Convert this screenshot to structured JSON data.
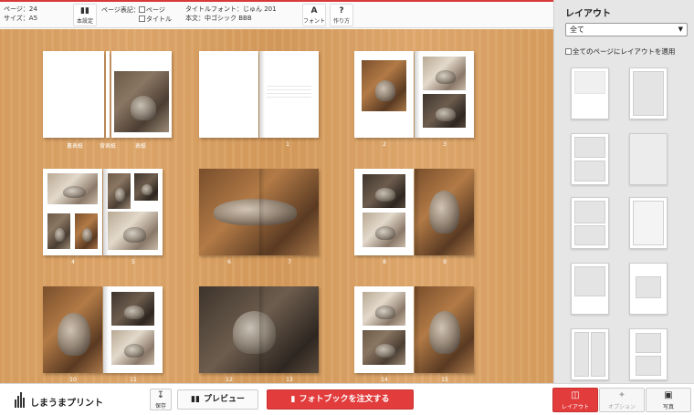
{
  "toolbar": {
    "page_count_label": "ページ：24",
    "size_label": "サイズ：A5",
    "book_settings_label": "本設定",
    "page_notation_label": "ページ表記：",
    "page_check_label": "ページ",
    "title_check_label": "タイトル",
    "title_font_label": "タイトルフォント：じゅん 201",
    "body_font_label": "本文：中ゴシック BBB",
    "font_button_label": "フォント",
    "help_button_label": "作り方"
  },
  "spreads": [
    {
      "captions": [
        "裏表紙",
        "背表紙",
        "表紙"
      ]
    },
    {
      "captions": [
        "1"
      ]
    },
    {
      "captions": [
        "2",
        "3"
      ]
    },
    {
      "captions": [
        "4",
        "5"
      ]
    },
    {
      "captions": [
        "6",
        "7"
      ]
    },
    {
      "captions": [
        "8",
        "9"
      ]
    },
    {
      "captions": [
        "10",
        "11"
      ]
    },
    {
      "captions": [
        "12",
        "13"
      ]
    },
    {
      "captions": [
        "14",
        "15"
      ]
    }
  ],
  "sidebar": {
    "title": "レイアウト",
    "select_value": "全て",
    "apply_all_label": "全てのページにレイアウトを適用"
  },
  "bottombar": {
    "logo_text": "しまうまプリント",
    "save_label": "保存",
    "preview_label": "プレビュー",
    "order_label": "フォトブックを注文する",
    "tabs": [
      {
        "label": "レイアウト",
        "icon": "layout-icon",
        "state": "active"
      },
      {
        "label": "オプション",
        "icon": "option-icon",
        "state": "disabled"
      },
      {
        "label": "写真",
        "icon": "photo-icon",
        "state": "normal"
      }
    ]
  },
  "colors": {
    "accent": "#e23c3c",
    "sidebar_bg": "#e6e6e6",
    "wood": "#d9a062"
  }
}
